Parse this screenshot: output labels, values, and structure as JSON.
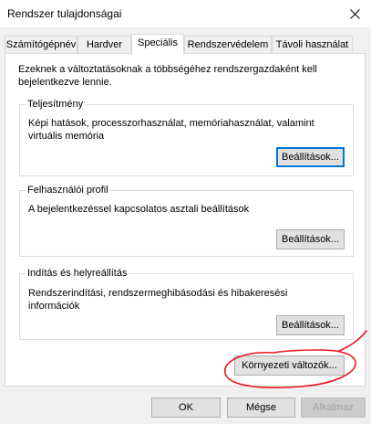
{
  "window": {
    "title": "Rendszer tulajdonságai"
  },
  "tabs": [
    {
      "label": "Számítógépnév",
      "active": false
    },
    {
      "label": "Hardver",
      "active": false
    },
    {
      "label": "Speciális",
      "active": true
    },
    {
      "label": "Rendszervédelem",
      "active": false
    },
    {
      "label": "Távoli használat",
      "active": false
    }
  ],
  "panel": {
    "intro": "Ezeknek a változtatásoknak a többségéhez rendszergazdaként kell bejelentkezve lennie.",
    "performance": {
      "title": "Teljesítmény",
      "description": "Képi hatások, processzorhasználat, memóriahasználat, valamint virtuális memória",
      "button": "Beállítások..."
    },
    "user_profiles": {
      "title": "Felhasználói profil",
      "description": "A bejelentkezéssel kapcsolatos asztali beállítások",
      "button": "Beállítások..."
    },
    "startup_recovery": {
      "title": "Indítás és helyreállítás",
      "description": "Rendszerindítási, rendszermeghibásodási és hibakeresési információk",
      "button": "Beállítások..."
    },
    "env_button": "Környezeti változók..."
  },
  "footer": {
    "ok": "OK",
    "cancel": "Mégse",
    "apply": "Alkalmaz"
  },
  "colors": {
    "accent": "#0078d7",
    "annotation": "#e8141c"
  }
}
